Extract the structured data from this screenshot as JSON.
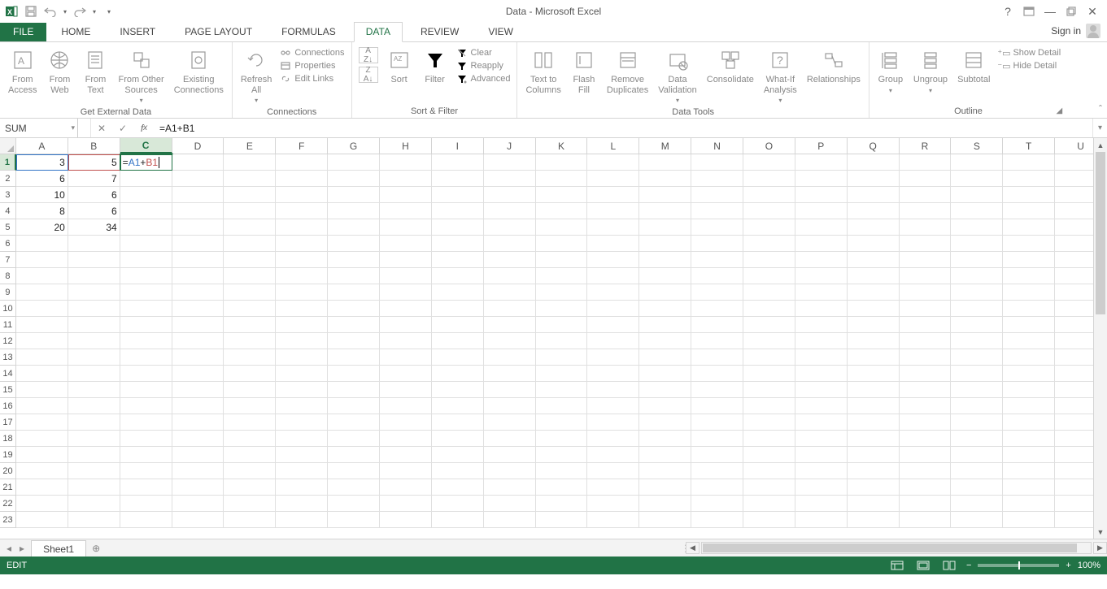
{
  "title": "Data - Microsoft Excel",
  "qat": {
    "undo_tip": "Undo",
    "redo_tip": "Redo",
    "save_tip": "Save"
  },
  "win": {
    "help": "?",
    "options": "▭",
    "min": "—",
    "restore": "❐",
    "close": "✕"
  },
  "tabs": {
    "file": "FILE",
    "home": "HOME",
    "insert": "INSERT",
    "page_layout": "PAGE LAYOUT",
    "formulas": "FORMULAS",
    "data": "DATA",
    "review": "REVIEW",
    "view": "VIEW",
    "active": "DATA",
    "signin": "Sign in"
  },
  "ribbon": {
    "groups": {
      "get_external": {
        "label": "Get External Data",
        "from_access": "From\nAccess",
        "from_web": "From\nWeb",
        "from_text": "From\nText",
        "from_other": "From Other\nSources",
        "existing": "Existing\nConnections"
      },
      "connections": {
        "label": "Connections",
        "refresh": "Refresh\nAll",
        "connections": "Connections",
        "properties": "Properties",
        "edit_links": "Edit Links"
      },
      "sort_filter": {
        "label": "Sort & Filter",
        "az": "A→Z",
        "za": "Z→A",
        "sort": "Sort",
        "filter": "Filter",
        "clear": "Clear",
        "reapply": "Reapply",
        "advanced": "Advanced"
      },
      "data_tools": {
        "label": "Data Tools",
        "text_to_columns": "Text to\nColumns",
        "flash_fill": "Flash\nFill",
        "remove_duplicates": "Remove\nDuplicates",
        "data_validation": "Data\nValidation",
        "consolidate": "Consolidate",
        "whatif": "What-If\nAnalysis",
        "relationships": "Relationships"
      },
      "outline": {
        "label": "Outline",
        "group": "Group",
        "ungroup": "Ungroup",
        "subtotal": "Subtotal",
        "show_detail": "Show Detail",
        "hide_detail": "Hide Detail"
      }
    }
  },
  "formula_bar": {
    "name_box": "SUM",
    "formula": "=A1+B1",
    "ref_a": "A1",
    "op": "+",
    "ref_b": "B1"
  },
  "grid": {
    "columns": [
      "A",
      "B",
      "C",
      "D",
      "E",
      "F",
      "G",
      "H",
      "I",
      "J",
      "K",
      "L",
      "M",
      "N",
      "O",
      "P",
      "Q",
      "R",
      "S",
      "T",
      "U"
    ],
    "active_col": "C",
    "active_row": 1,
    "num_rows": 23,
    "data": {
      "A": {
        "1": "3",
        "2": "6",
        "3": "10",
        "4": "8",
        "5": "20"
      },
      "B": {
        "1": "5",
        "2": "7",
        "3": "6",
        "4": "6",
        "5": "34"
      }
    },
    "editing_cell": {
      "col": "C",
      "row": 1,
      "display": "=A1+B1"
    }
  },
  "sheet_tabs": {
    "active": "Sheet1"
  },
  "status": {
    "mode": "EDIT",
    "zoom": "100%"
  },
  "colors": {
    "accent": "#217346",
    "ref_a": "#3173c6",
    "ref_b": "#c0504d"
  }
}
